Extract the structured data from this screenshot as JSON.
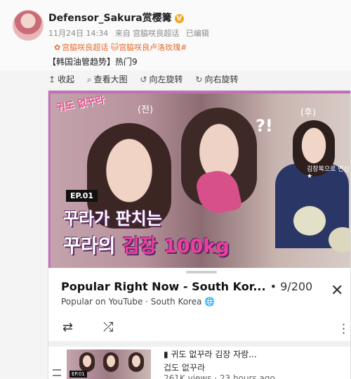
{
  "post": {
    "username": "Defensor_Sakura赏樱篝",
    "verified_badge": "V",
    "time": "11月24日 14:34",
    "source": "来自 宫脇咲良超话",
    "edited": "已编辑",
    "tags": [
      "宫脇咲良超话",
      "宫脇咲良卢洛玫瑰#"
    ],
    "trend_label": "【韩国油管趋势】",
    "trend_rank": "热门9"
  },
  "toolbar": {
    "collapse": "收起",
    "view_large": "查看大图",
    "rotate_left": "向左旋转",
    "rotate_right": "向右旋转"
  },
  "thumbnail": {
    "logo": "귀도 없꾸라",
    "before": "(전)",
    "after": "(후)",
    "question": "?!",
    "side_note": "김장복으로 변신★",
    "episode": "EP.01",
    "line1": "꾸라가 판치는",
    "line2_a": "꾸라의 ",
    "line2_b": "김장 100kg"
  },
  "player": {
    "title": "Popular Right Now - South Kor...",
    "count": "• 9/200",
    "subtitle": "Popular on YouTube · South Korea",
    "globe_icon": "globe-icon",
    "loop_icon": "loop-icon",
    "shuffle_icon": "shuffle-icon",
    "close_icon": "close-icon"
  },
  "next_item": {
    "title": "▮ 귀도 없꾸라 김장 자랑...",
    "channel": "겁도 없꾸라",
    "views": "261K views · 23 hours ago",
    "episode": "EP.01"
  }
}
